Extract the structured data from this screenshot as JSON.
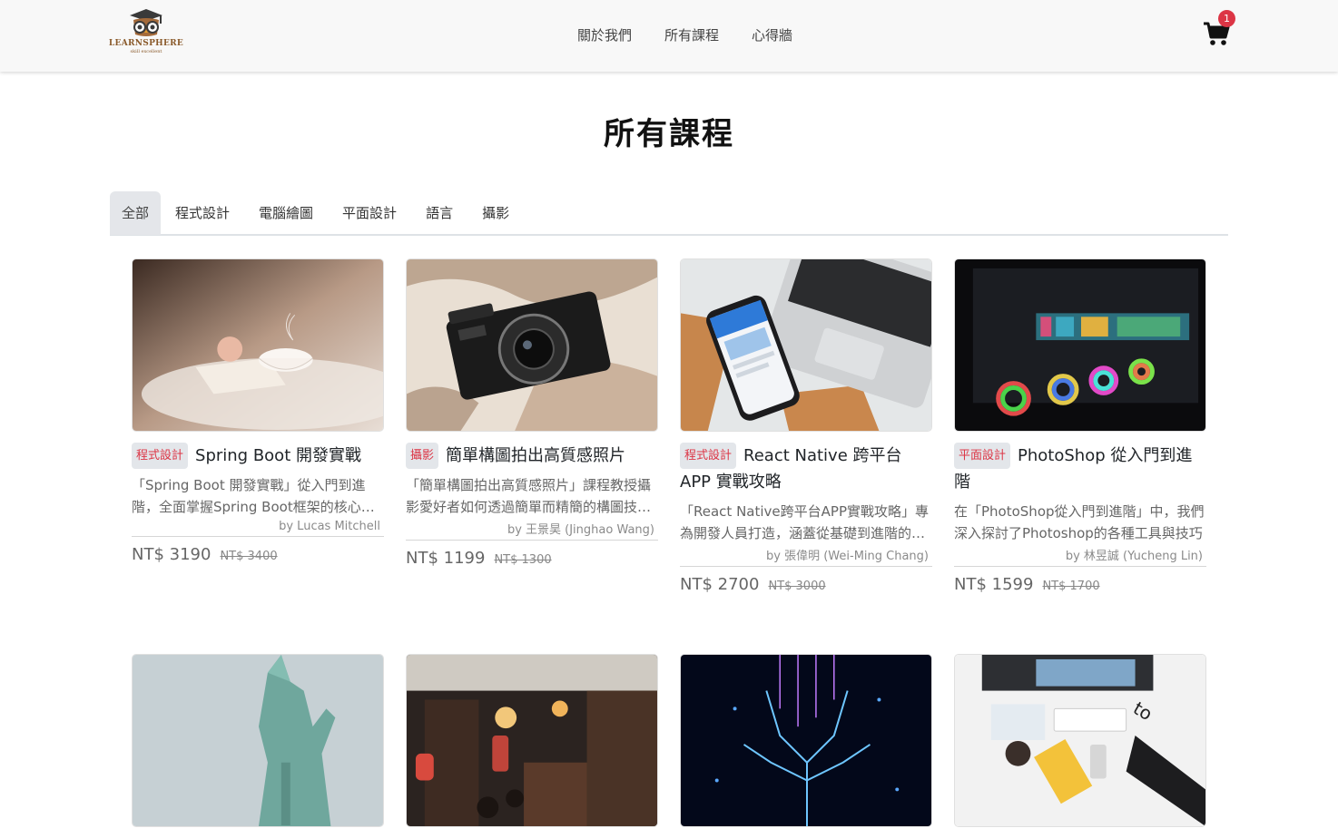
{
  "nav": {
    "logo_text": "LEARNSPHERE",
    "logo_sub": "skill excellent",
    "links": [
      "關於我們",
      "所有課程",
      "心得牆"
    ],
    "cart_count": "1"
  },
  "page": {
    "title": "所有課程"
  },
  "tabs": [
    "全部",
    "程式設計",
    "電腦繪圖",
    "平面設計",
    "語言",
    "攝影"
  ],
  "courses": [
    {
      "category": "程式設計",
      "title": "Spring Boot 開發實戰",
      "desc": "「Spring Boot 開發實戰」從入門到進階，全面掌握Spring Boot框架的核心技術與實務應用",
      "author": "by Lucas Mitchell",
      "price": "NT$ 3190",
      "old_price": "NT$ 3400"
    },
    {
      "category": "攝影",
      "title": "簡單構圖拍出高質感照片",
      "desc": "「簡單構圖拍出高質感照片」課程教授攝影愛好者如何透過簡單而精簡的構圖技巧拍出好照片",
      "author": "by 王景昊 (Jinghao Wang)",
      "price": "NT$ 1199",
      "old_price": "NT$ 1300"
    },
    {
      "category": "程式設計",
      "title": "React Native 跨平台 APP 實戰攻略",
      "desc": "「React Native跨平台APP實戰攻略」專為開發人員打造，涵蓋從基礎到進階的完整內容",
      "author": "by 張偉明 (Wei-Ming Chang)",
      "price": "NT$ 2700",
      "old_price": "NT$ 3000"
    },
    {
      "category": "平面設計",
      "title": "PhotoShop 從入門到進階",
      "desc": "在「PhotoShop從入門到進階」中，我們深入探討了Photoshop的各種工具與技巧",
      "author": "by 林昱誠 (Yucheng Lin)",
      "price": "NT$ 1599",
      "old_price": "NT$ 1700"
    }
  ],
  "colors": {
    "badge_text": "#dc3545",
    "cart_badge": "#dc3545",
    "navbar_bg": "#f8f8f8"
  }
}
